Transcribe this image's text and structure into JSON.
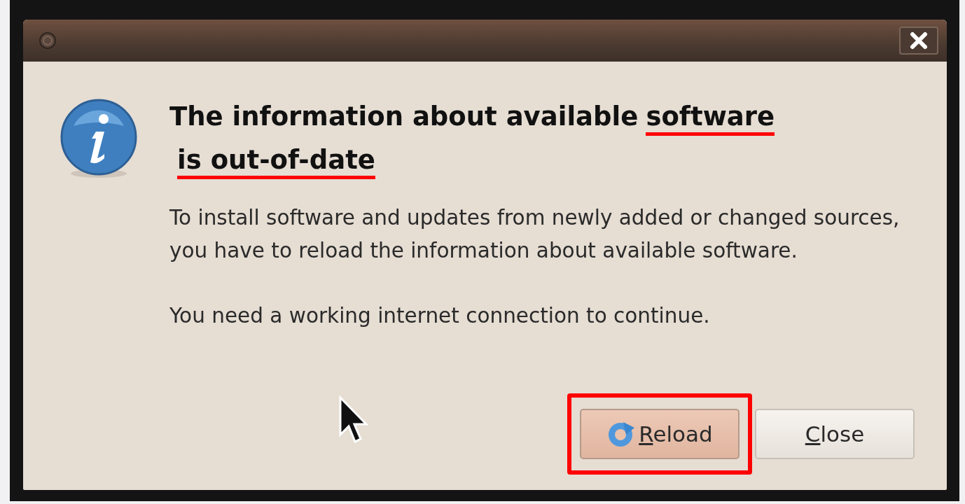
{
  "dialog": {
    "heading": [
      {
        "text": "The information about available",
        "highlighted": false
      },
      {
        "text": "software",
        "highlighted": true
      },
      {
        "text": "is out-of-date",
        "highlighted": true
      }
    ],
    "paragraphs": [
      "To install software and updates from newly added or changed sources, you have to reload the information about available software.",
      "You need a working internet connection to continue."
    ],
    "buttons": [
      {
        "label": "Reload",
        "kind": "reload",
        "highlighted": true
      },
      {
        "label": "Close",
        "kind": "plain",
        "highlighted": false
      }
    ]
  }
}
